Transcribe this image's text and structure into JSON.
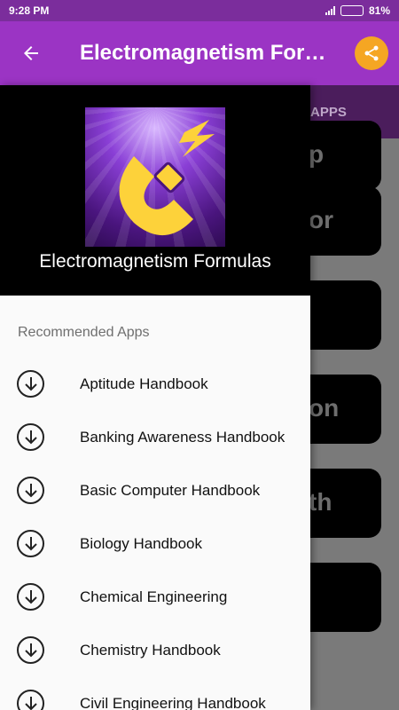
{
  "status_bar": {
    "time": "9:28 PM",
    "battery": "81%",
    "battery_level": 0.81
  },
  "app_bar": {
    "title": "Electromagnetism Formulas",
    "back_icon": "arrow-left-icon",
    "share_icon": "share-icon",
    "accent_color": "#f5a623",
    "background_color": "#9b34c4"
  },
  "background": {
    "tab_text": "APPS",
    "cards": [
      "p",
      "or",
      "",
      "on",
      "th",
      ""
    ]
  },
  "drawer": {
    "app_name": "Electromagnetism Formulas",
    "logo_icon": "magnet-lightning-icon",
    "section_title": "Recommended Apps",
    "items": [
      {
        "label": "Aptitude Handbook",
        "icon": "download-icon"
      },
      {
        "label": "Banking Awareness Handbook",
        "icon": "download-icon"
      },
      {
        "label": "Basic Computer Handbook",
        "icon": "download-icon"
      },
      {
        "label": "Biology Handbook",
        "icon": "download-icon"
      },
      {
        "label": "Chemical Engineering",
        "icon": "download-icon"
      },
      {
        "label": "Chemistry Handbook",
        "icon": "download-icon"
      },
      {
        "label": "Civil Engineering Handbook",
        "icon": "download-icon"
      }
    ]
  }
}
